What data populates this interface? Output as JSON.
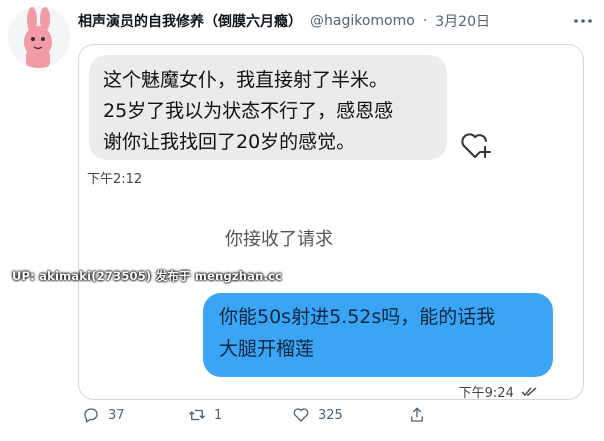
{
  "tweet": {
    "author_name": "相声演员的自我修养（倒膜六月瘾）",
    "handle": "@hagikomomo",
    "separator": "·",
    "date": "3月20日",
    "more_icon": "more-horizontal-icon",
    "avatar_icon": "pink-rabbit-avatar"
  },
  "chat": {
    "incoming_message": "这个魅魔女仆，我直接射了半米。\n25岁了我以为状态不行了，感恩感\n谢你让我找回了20岁的感觉。",
    "incoming_time": "下午2:12",
    "reaction_icon": "heart-add-icon",
    "system_message": "你接收了请求",
    "outgoing_message": "你能50s射进5.52s吗，能的话我\n大腿开榴莲",
    "outgoing_time": "下午9:24",
    "read_icon": "double-check-icon",
    "watermark": "UP: akimaki(273505) 发布于 mengzhan.cc"
  },
  "actions": {
    "reply_count": "37",
    "retweet_count": "1",
    "like_count": "325",
    "reply_icon": "reply-icon",
    "retweet_icon": "retweet-icon",
    "like_icon": "heart-icon",
    "share_icon": "share-icon"
  },
  "colors": {
    "incoming_bubble": "#e9ebed",
    "outgoing_bubble": "#3ba4f5",
    "muted_text": "#536471"
  }
}
